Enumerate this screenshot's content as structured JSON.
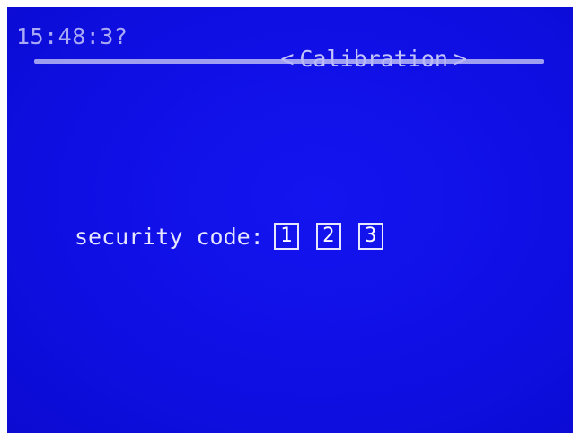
{
  "header": {
    "clock": "15:48:3?",
    "prev_arrow": "<",
    "title": "Calibration",
    "next_arrow": ">"
  },
  "security": {
    "label": "security code:",
    "digits": [
      "1",
      "2",
      "3"
    ]
  },
  "colors": {
    "screen_background": "#1010e6",
    "text": "#e6e6ff",
    "header_text": "#a9a9f6"
  }
}
